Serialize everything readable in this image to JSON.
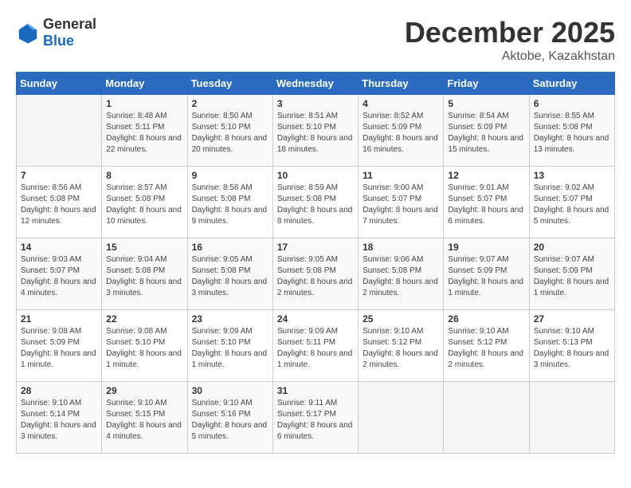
{
  "logo": {
    "general": "General",
    "blue": "Blue"
  },
  "title": {
    "month": "December 2025",
    "location": "Aktobe, Kazakhstan"
  },
  "weekdays": [
    "Sunday",
    "Monday",
    "Tuesday",
    "Wednesday",
    "Thursday",
    "Friday",
    "Saturday"
  ],
  "weeks": [
    [
      {
        "day": "",
        "sunrise": "",
        "sunset": "",
        "daylight": ""
      },
      {
        "day": "1",
        "sunrise": "Sunrise: 8:48 AM",
        "sunset": "Sunset: 5:11 PM",
        "daylight": "Daylight: 8 hours and 22 minutes."
      },
      {
        "day": "2",
        "sunrise": "Sunrise: 8:50 AM",
        "sunset": "Sunset: 5:10 PM",
        "daylight": "Daylight: 8 hours and 20 minutes."
      },
      {
        "day": "3",
        "sunrise": "Sunrise: 8:51 AM",
        "sunset": "Sunset: 5:10 PM",
        "daylight": "Daylight: 8 hours and 18 minutes."
      },
      {
        "day": "4",
        "sunrise": "Sunrise: 8:52 AM",
        "sunset": "Sunset: 5:09 PM",
        "daylight": "Daylight: 8 hours and 16 minutes."
      },
      {
        "day": "5",
        "sunrise": "Sunrise: 8:54 AM",
        "sunset": "Sunset: 5:09 PM",
        "daylight": "Daylight: 8 hours and 15 minutes."
      },
      {
        "day": "6",
        "sunrise": "Sunrise: 8:55 AM",
        "sunset": "Sunset: 5:08 PM",
        "daylight": "Daylight: 8 hours and 13 minutes."
      }
    ],
    [
      {
        "day": "7",
        "sunrise": "Sunrise: 8:56 AM",
        "sunset": "Sunset: 5:08 PM",
        "daylight": "Daylight: 8 hours and 12 minutes."
      },
      {
        "day": "8",
        "sunrise": "Sunrise: 8:57 AM",
        "sunset": "Sunset: 5:08 PM",
        "daylight": "Daylight: 8 hours and 10 minutes."
      },
      {
        "day": "9",
        "sunrise": "Sunrise: 8:58 AM",
        "sunset": "Sunset: 5:08 PM",
        "daylight": "Daylight: 8 hours and 9 minutes."
      },
      {
        "day": "10",
        "sunrise": "Sunrise: 8:59 AM",
        "sunset": "Sunset: 5:08 PM",
        "daylight": "Daylight: 8 hours and 8 minutes."
      },
      {
        "day": "11",
        "sunrise": "Sunrise: 9:00 AM",
        "sunset": "Sunset: 5:07 PM",
        "daylight": "Daylight: 8 hours and 7 minutes."
      },
      {
        "day": "12",
        "sunrise": "Sunrise: 9:01 AM",
        "sunset": "Sunset: 5:07 PM",
        "daylight": "Daylight: 8 hours and 6 minutes."
      },
      {
        "day": "13",
        "sunrise": "Sunrise: 9:02 AM",
        "sunset": "Sunset: 5:07 PM",
        "daylight": "Daylight: 8 hours and 5 minutes."
      }
    ],
    [
      {
        "day": "14",
        "sunrise": "Sunrise: 9:03 AM",
        "sunset": "Sunset: 5:07 PM",
        "daylight": "Daylight: 8 hours and 4 minutes."
      },
      {
        "day": "15",
        "sunrise": "Sunrise: 9:04 AM",
        "sunset": "Sunset: 5:08 PM",
        "daylight": "Daylight: 8 hours and 3 minutes."
      },
      {
        "day": "16",
        "sunrise": "Sunrise: 9:05 AM",
        "sunset": "Sunset: 5:08 PM",
        "daylight": "Daylight: 8 hours and 3 minutes."
      },
      {
        "day": "17",
        "sunrise": "Sunrise: 9:05 AM",
        "sunset": "Sunset: 5:08 PM",
        "daylight": "Daylight: 8 hours and 2 minutes."
      },
      {
        "day": "18",
        "sunrise": "Sunrise: 9:06 AM",
        "sunset": "Sunset: 5:08 PM",
        "daylight": "Daylight: 8 hours and 2 minutes."
      },
      {
        "day": "19",
        "sunrise": "Sunrise: 9:07 AM",
        "sunset": "Sunset: 5:09 PM",
        "daylight": "Daylight: 8 hours and 1 minute."
      },
      {
        "day": "20",
        "sunrise": "Sunrise: 9:07 AM",
        "sunset": "Sunset: 5:09 PM",
        "daylight": "Daylight: 8 hours and 1 minute."
      }
    ],
    [
      {
        "day": "21",
        "sunrise": "Sunrise: 9:08 AM",
        "sunset": "Sunset: 5:09 PM",
        "daylight": "Daylight: 8 hours and 1 minute."
      },
      {
        "day": "22",
        "sunrise": "Sunrise: 9:08 AM",
        "sunset": "Sunset: 5:10 PM",
        "daylight": "Daylight: 8 hours and 1 minute."
      },
      {
        "day": "23",
        "sunrise": "Sunrise: 9:09 AM",
        "sunset": "Sunset: 5:10 PM",
        "daylight": "Daylight: 8 hours and 1 minute."
      },
      {
        "day": "24",
        "sunrise": "Sunrise: 9:09 AM",
        "sunset": "Sunset: 5:11 PM",
        "daylight": "Daylight: 8 hours and 1 minute."
      },
      {
        "day": "25",
        "sunrise": "Sunrise: 9:10 AM",
        "sunset": "Sunset: 5:12 PM",
        "daylight": "Daylight: 8 hours and 2 minutes."
      },
      {
        "day": "26",
        "sunrise": "Sunrise: 9:10 AM",
        "sunset": "Sunset: 5:12 PM",
        "daylight": "Daylight: 8 hours and 2 minutes."
      },
      {
        "day": "27",
        "sunrise": "Sunrise: 9:10 AM",
        "sunset": "Sunset: 5:13 PM",
        "daylight": "Daylight: 8 hours and 3 minutes."
      }
    ],
    [
      {
        "day": "28",
        "sunrise": "Sunrise: 9:10 AM",
        "sunset": "Sunset: 5:14 PM",
        "daylight": "Daylight: 8 hours and 3 minutes."
      },
      {
        "day": "29",
        "sunrise": "Sunrise: 9:10 AM",
        "sunset": "Sunset: 5:15 PM",
        "daylight": "Daylight: 8 hours and 4 minutes."
      },
      {
        "day": "30",
        "sunrise": "Sunrise: 9:10 AM",
        "sunset": "Sunset: 5:16 PM",
        "daylight": "Daylight: 8 hours and 5 minutes."
      },
      {
        "day": "31",
        "sunrise": "Sunrise: 9:11 AM",
        "sunset": "Sunset: 5:17 PM",
        "daylight": "Daylight: 8 hours and 6 minutes."
      },
      {
        "day": "",
        "sunrise": "",
        "sunset": "",
        "daylight": ""
      },
      {
        "day": "",
        "sunrise": "",
        "sunset": "",
        "daylight": ""
      },
      {
        "day": "",
        "sunrise": "",
        "sunset": "",
        "daylight": ""
      }
    ]
  ]
}
